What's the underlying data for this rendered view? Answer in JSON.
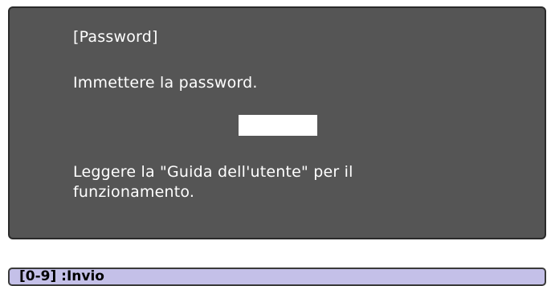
{
  "dialog": {
    "title": "[Password]",
    "prompt": "Immettere la password.",
    "password_value": "",
    "help_text": "Leggere la \"Guida dell'utente\" per il funzionamento."
  },
  "status_bar": {
    "hint": "[0-9] :Invio"
  },
  "colors": {
    "dialog_background": "#555555",
    "text": "#ffffff",
    "status_bar_background": "#c4c0e8"
  }
}
